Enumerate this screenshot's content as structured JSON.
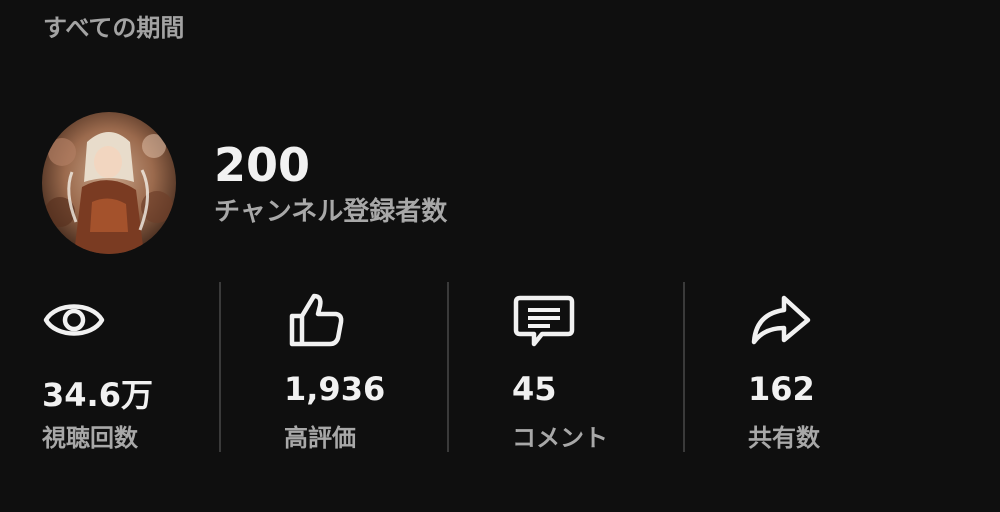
{
  "period_label": "すべての期間",
  "channel": {
    "subscriber_count": "200",
    "subscriber_label": "チャンネル登録者数"
  },
  "stats": [
    {
      "icon": "eye-icon",
      "value": "34.6万",
      "label": "視聴回数"
    },
    {
      "icon": "thumbs-up-icon",
      "value": "1,936",
      "label": "高評価"
    },
    {
      "icon": "comment-icon",
      "value": "45",
      "label": "コメント"
    },
    {
      "icon": "share-icon",
      "value": "162",
      "label": "共有数"
    }
  ],
  "colors": {
    "background": "#0f0f0f",
    "primary_text": "#f1f1f1",
    "secondary_text": "#a8a8a8",
    "divider": "#3a3a3a"
  }
}
